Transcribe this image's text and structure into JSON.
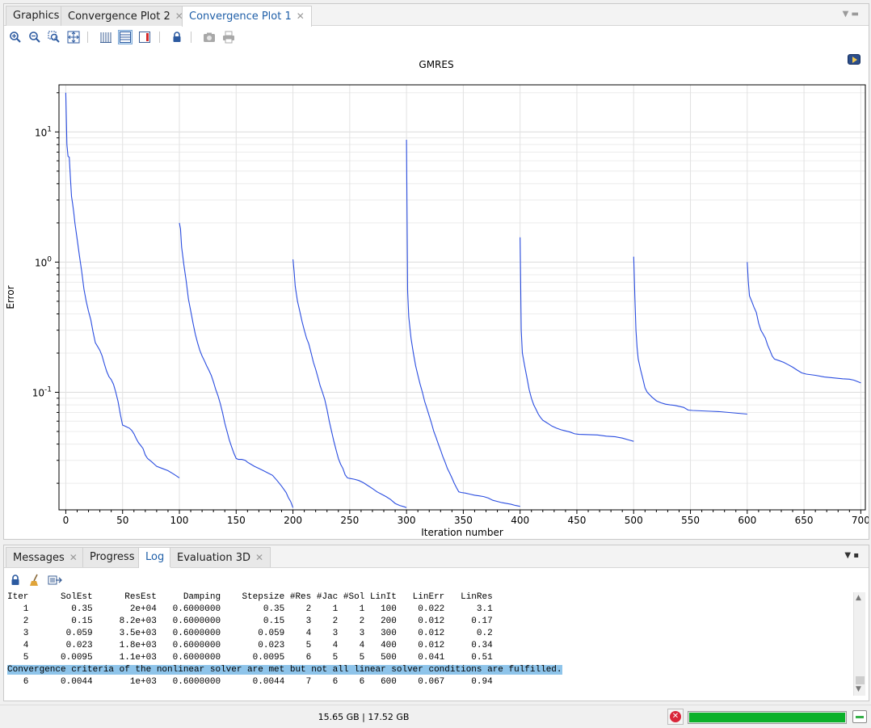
{
  "top_tabs": [
    {
      "label": "Graphics",
      "closable": false,
      "active": false
    },
    {
      "label": "Convergence Plot 2",
      "closable": true,
      "active": false
    },
    {
      "label": "Convergence Plot 1",
      "closable": true,
      "active": true
    }
  ],
  "toolbar_icons": [
    "zoom-in-icon",
    "zoom-out-icon",
    "zoom-box-icon",
    "zoom-extents-icon",
    "grid-lines-icon",
    "legend-table-icon",
    "legend-color-icon",
    "lock-icon",
    "camera-icon",
    "print-icon"
  ],
  "chart_data": {
    "type": "line",
    "title": "GMRES",
    "xlabel": "Iteration number",
    "ylabel": "Error",
    "xlim": [
      -6,
      704
    ],
    "ylim": [
      0.0125,
      23
    ],
    "yscale": "log",
    "grid": true,
    "color": "#2a4de0",
    "xticks": [
      "0",
      "50",
      "100",
      "150",
      "200",
      "250",
      "300",
      "350",
      "400",
      "450",
      "500",
      "550",
      "600",
      "650",
      "700"
    ],
    "xtick_values": [
      0,
      50,
      100,
      150,
      200,
      250,
      300,
      350,
      400,
      450,
      500,
      550,
      600,
      650,
      700
    ],
    "yticks": [
      {
        "value": 10,
        "base": "10",
        "exp": "1"
      },
      {
        "value": 1,
        "base": "10",
        "exp": "0"
      },
      {
        "value": 0.1,
        "base": "10",
        "exp": "-1"
      }
    ],
    "series": [
      {
        "points": [
          [
            0,
            20
          ],
          [
            1,
            8
          ],
          [
            2,
            6.5
          ],
          [
            3,
            6.4
          ],
          [
            4,
            4.5
          ],
          [
            5,
            3.2
          ],
          [
            6,
            2.8
          ],
          [
            7,
            2.4
          ],
          [
            8,
            2.0
          ],
          [
            10,
            1.5
          ],
          [
            12,
            1.12
          ],
          [
            14,
            0.85
          ],
          [
            16,
            0.62
          ],
          [
            18,
            0.5
          ],
          [
            20,
            0.42
          ],
          [
            22,
            0.36
          ],
          [
            24,
            0.29
          ],
          [
            26,
            0.24
          ],
          [
            28,
            0.225
          ],
          [
            30,
            0.21
          ],
          [
            32,
            0.19
          ],
          [
            34,
            0.165
          ],
          [
            36,
            0.145
          ],
          [
            38,
            0.132
          ],
          [
            40,
            0.125
          ],
          [
            42,
            0.115
          ],
          [
            44,
            0.1
          ],
          [
            46,
            0.085
          ],
          [
            48,
            0.068
          ],
          [
            50,
            0.056
          ],
          [
            52,
            0.055
          ],
          [
            54,
            0.054
          ],
          [
            56,
            0.053
          ],
          [
            58,
            0.051
          ],
          [
            60,
            0.048
          ],
          [
            62,
            0.044
          ],
          [
            64,
            0.041
          ],
          [
            66,
            0.039
          ],
          [
            68,
            0.037
          ],
          [
            70,
            0.033
          ],
          [
            72,
            0.031
          ],
          [
            74,
            0.03
          ],
          [
            76,
            0.029
          ],
          [
            78,
            0.028
          ],
          [
            80,
            0.027
          ],
          [
            85,
            0.026
          ],
          [
            90,
            0.025
          ],
          [
            95,
            0.0235
          ],
          [
            100,
            0.022
          ]
        ]
      },
      {
        "points": [
          [
            100,
            2.0
          ],
          [
            101,
            1.8
          ],
          [
            102,
            1.3
          ],
          [
            104,
            0.95
          ],
          [
            106,
            0.72
          ],
          [
            108,
            0.52
          ],
          [
            110,
            0.42
          ],
          [
            112,
            0.34
          ],
          [
            114,
            0.28
          ],
          [
            116,
            0.24
          ],
          [
            118,
            0.21
          ],
          [
            120,
            0.19
          ],
          [
            122,
            0.175
          ],
          [
            124,
            0.16
          ],
          [
            126,
            0.148
          ],
          [
            128,
            0.135
          ],
          [
            130,
            0.12
          ],
          [
            132,
            0.105
          ],
          [
            134,
            0.094
          ],
          [
            136,
            0.082
          ],
          [
            138,
            0.07
          ],
          [
            140,
            0.058
          ],
          [
            142,
            0.05
          ],
          [
            144,
            0.043
          ],
          [
            146,
            0.038
          ],
          [
            148,
            0.034
          ],
          [
            150,
            0.031
          ],
          [
            152,
            0.0305
          ],
          [
            155,
            0.0305
          ],
          [
            158,
            0.03
          ],
          [
            160,
            0.029
          ],
          [
            163,
            0.028
          ],
          [
            166,
            0.027
          ],
          [
            170,
            0.026
          ],
          [
            174,
            0.025
          ],
          [
            178,
            0.024
          ],
          [
            182,
            0.023
          ],
          [
            186,
            0.021
          ],
          [
            190,
            0.019
          ],
          [
            194,
            0.017
          ],
          [
            196,
            0.0155
          ],
          [
            198,
            0.0145
          ],
          [
            200,
            0.013
          ]
        ]
      },
      {
        "points": [
          [
            200,
            1.05
          ],
          [
            201,
            0.85
          ],
          [
            202,
            0.65
          ],
          [
            204,
            0.5
          ],
          [
            206,
            0.42
          ],
          [
            208,
            0.35
          ],
          [
            210,
            0.3
          ],
          [
            212,
            0.26
          ],
          [
            214,
            0.235
          ],
          [
            216,
            0.2
          ],
          [
            218,
            0.17
          ],
          [
            220,
            0.15
          ],
          [
            222,
            0.13
          ],
          [
            224,
            0.112
          ],
          [
            226,
            0.1
          ],
          [
            228,
            0.088
          ],
          [
            230,
            0.074
          ],
          [
            232,
            0.06
          ],
          [
            234,
            0.05
          ],
          [
            236,
            0.042
          ],
          [
            238,
            0.036
          ],
          [
            240,
            0.031
          ],
          [
            242,
            0.028
          ],
          [
            244,
            0.026
          ],
          [
            246,
            0.0232
          ],
          [
            248,
            0.022
          ],
          [
            250,
            0.0218
          ],
          [
            254,
            0.0215
          ],
          [
            258,
            0.021
          ],
          [
            262,
            0.0202
          ],
          [
            266,
            0.0192
          ],
          [
            270,
            0.0182
          ],
          [
            274,
            0.0172
          ],
          [
            278,
            0.0165
          ],
          [
            282,
            0.0158
          ],
          [
            286,
            0.015
          ],
          [
            290,
            0.014
          ],
          [
            294,
            0.0135
          ],
          [
            298,
            0.0132
          ],
          [
            300,
            0.013
          ]
        ]
      },
      {
        "points": [
          [
            300,
            8.7
          ],
          [
            301,
            0.6
          ],
          [
            302,
            0.38
          ],
          [
            304,
            0.26
          ],
          [
            306,
            0.2
          ],
          [
            308,
            0.16
          ],
          [
            310,
            0.135
          ],
          [
            312,
            0.115
          ],
          [
            314,
            0.1
          ],
          [
            316,
            0.085
          ],
          [
            318,
            0.075
          ],
          [
            320,
            0.066
          ],
          [
            322,
            0.058
          ],
          [
            324,
            0.05
          ],
          [
            326,
            0.045
          ],
          [
            328,
            0.04
          ],
          [
            330,
            0.036
          ],
          [
            332,
            0.032
          ],
          [
            334,
            0.029
          ],
          [
            336,
            0.026
          ],
          [
            338,
            0.024
          ],
          [
            340,
            0.022
          ],
          [
            342,
            0.02
          ],
          [
            344,
            0.0185
          ],
          [
            346,
            0.0172
          ],
          [
            348,
            0.017
          ],
          [
            352,
            0.0168
          ],
          [
            356,
            0.0165
          ],
          [
            360,
            0.0162
          ],
          [
            364,
            0.016
          ],
          [
            368,
            0.0158
          ],
          [
            372,
            0.0154
          ],
          [
            376,
            0.0148
          ],
          [
            380,
            0.0145
          ],
          [
            384,
            0.0142
          ],
          [
            388,
            0.014
          ],
          [
            392,
            0.0138
          ],
          [
            396,
            0.0135
          ],
          [
            400,
            0.0133
          ]
        ]
      },
      {
        "points": [
          [
            400,
            1.55
          ],
          [
            401,
            0.3
          ],
          [
            402,
            0.2
          ],
          [
            404,
            0.16
          ],
          [
            406,
            0.13
          ],
          [
            408,
            0.105
          ],
          [
            410,
            0.09
          ],
          [
            412,
            0.08
          ],
          [
            414,
            0.074
          ],
          [
            416,
            0.068
          ],
          [
            418,
            0.064
          ],
          [
            420,
            0.061
          ],
          [
            424,
            0.058
          ],
          [
            428,
            0.055
          ],
          [
            432,
            0.053
          ],
          [
            436,
            0.0515
          ],
          [
            440,
            0.0505
          ],
          [
            444,
            0.0495
          ],
          [
            448,
            0.048
          ],
          [
            452,
            0.0475
          ],
          [
            460,
            0.0473
          ],
          [
            468,
            0.047
          ],
          [
            476,
            0.046
          ],
          [
            484,
            0.0455
          ],
          [
            490,
            0.0445
          ],
          [
            496,
            0.043
          ],
          [
            500,
            0.042
          ]
        ]
      },
      {
        "points": [
          [
            500,
            1.1
          ],
          [
            501,
            0.55
          ],
          [
            502,
            0.3
          ],
          [
            503,
            0.22
          ],
          [
            504,
            0.18
          ],
          [
            506,
            0.15
          ],
          [
            508,
            0.128
          ],
          [
            510,
            0.108
          ],
          [
            512,
            0.1
          ],
          [
            514,
            0.096
          ],
          [
            516,
            0.092
          ],
          [
            518,
            0.089
          ],
          [
            520,
            0.086
          ],
          [
            524,
            0.083
          ],
          [
            528,
            0.081
          ],
          [
            532,
            0.08
          ],
          [
            536,
            0.0793
          ],
          [
            540,
            0.078
          ],
          [
            544,
            0.0765
          ],
          [
            548,
            0.073
          ],
          [
            552,
            0.0725
          ],
          [
            560,
            0.072
          ],
          [
            568,
            0.0715
          ],
          [
            576,
            0.071
          ],
          [
            584,
            0.07
          ],
          [
            592,
            0.069
          ],
          [
            600,
            0.068
          ]
        ]
      },
      {
        "points": [
          [
            600,
            1.0
          ],
          [
            601,
            0.7
          ],
          [
            602,
            0.55
          ],
          [
            604,
            0.5
          ],
          [
            606,
            0.45
          ],
          [
            608,
            0.41
          ],
          [
            610,
            0.34
          ],
          [
            612,
            0.3
          ],
          [
            614,
            0.28
          ],
          [
            616,
            0.26
          ],
          [
            618,
            0.23
          ],
          [
            620,
            0.21
          ],
          [
            622,
            0.19
          ],
          [
            624,
            0.18
          ],
          [
            628,
            0.175
          ],
          [
            632,
            0.17
          ],
          [
            636,
            0.163
          ],
          [
            640,
            0.156
          ],
          [
            644,
            0.148
          ],
          [
            648,
            0.141
          ],
          [
            652,
            0.138
          ],
          [
            660,
            0.135
          ],
          [
            668,
            0.131
          ],
          [
            676,
            0.129
          ],
          [
            684,
            0.127
          ],
          [
            690,
            0.126
          ],
          [
            694,
            0.124
          ],
          [
            698,
            0.12
          ],
          [
            700,
            0.118
          ]
        ]
      }
    ]
  },
  "bottom_tabs": [
    {
      "label": "Messages",
      "closable": true,
      "active": false
    },
    {
      "label": "Progress",
      "closable": false,
      "active": false
    },
    {
      "label": "Log",
      "closable": false,
      "active": true
    },
    {
      "label": "Evaluation 3D",
      "closable": true,
      "active": false
    }
  ],
  "log_lines": [
    {
      "text": "Iter      SolEst      ResEst     Damping    Stepsize #Res #Jac #Sol LinIt   LinErr   LinRes",
      "highlight": false
    },
    {
      "text": "   1        0.35       2e+04   0.6000000        0.35    2    1    1   100    0.022      3.1",
      "highlight": false
    },
    {
      "text": "   2        0.15     8.2e+03   0.6000000        0.15    3    2    2   200    0.012     0.17",
      "highlight": false
    },
    {
      "text": "   3       0.059     3.5e+03   0.6000000       0.059    4    3    3   300    0.012      0.2",
      "highlight": false
    },
    {
      "text": "   4       0.023     1.8e+03   0.6000000       0.023    5    4    4   400    0.012     0.34",
      "highlight": false
    },
    {
      "text": "   5      0.0095     1.1e+03   0.6000000      0.0095    6    5    5   500    0.041     0.51",
      "highlight": false
    },
    {
      "text": "Convergence criteria of the nonlinear solver are met but not all linear solver conditions are fulfilled.",
      "highlight": true
    },
    {
      "text": "   6      0.0044       1e+03   0.6000000      0.0044    7    6    6   600    0.067     0.94",
      "highlight": false
    }
  ],
  "status": {
    "memory": "15.65 GB | 17.52 GB",
    "progress": 1.0
  }
}
